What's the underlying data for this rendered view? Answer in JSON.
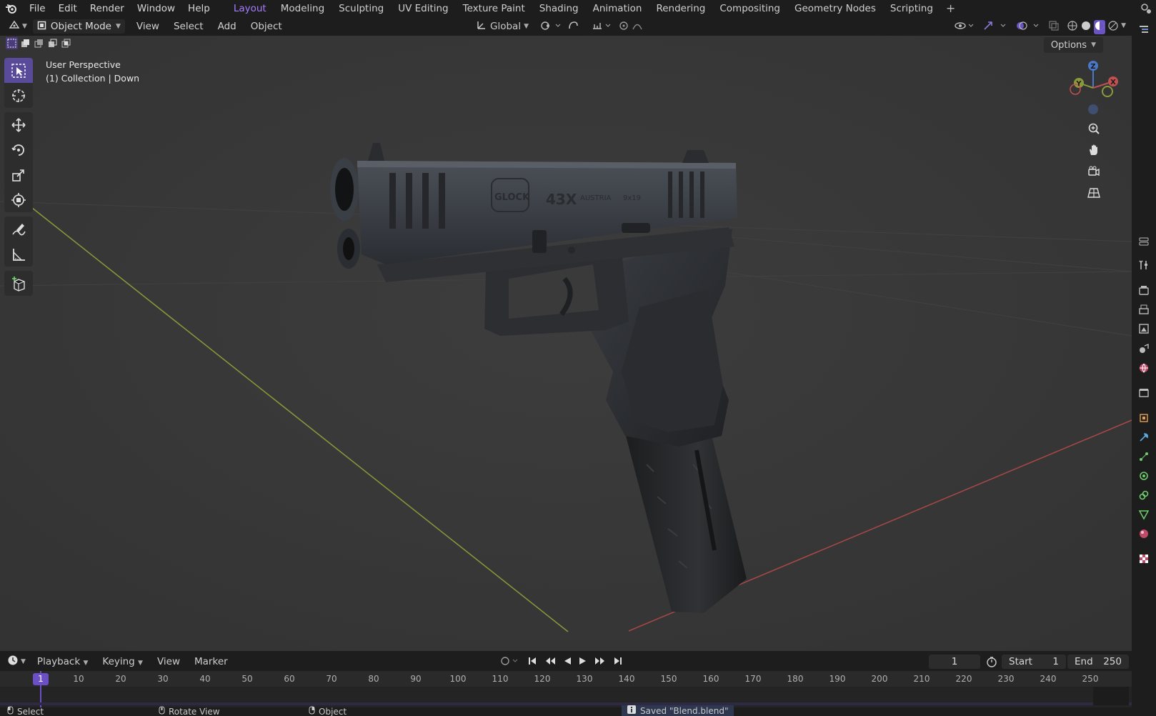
{
  "menu": {
    "file": "File",
    "edit": "Edit",
    "render": "Render",
    "window": "Window",
    "help": "Help"
  },
  "workspaces": [
    {
      "label": "Layout",
      "active": true
    },
    {
      "label": "Modeling"
    },
    {
      "label": "Sculpting"
    },
    {
      "label": "UV Editing"
    },
    {
      "label": "Texture Paint"
    },
    {
      "label": "Shading"
    },
    {
      "label": "Animation"
    },
    {
      "label": "Rendering"
    },
    {
      "label": "Compositing"
    },
    {
      "label": "Geometry Nodes"
    },
    {
      "label": "Scripting"
    }
  ],
  "workspace_add": "+",
  "viewport_header": {
    "mode": "Object Mode",
    "view": "View",
    "select": "Select",
    "add": "Add",
    "object": "Object",
    "orientation": "Global"
  },
  "viewport": {
    "perspective_label": "User Perspective",
    "collection_label": "(1) Collection | Down",
    "options_label": "Options",
    "gizmo_axes": {
      "z": "Z",
      "y": "Y",
      "x": "X"
    }
  },
  "timeline_header": {
    "playback": "Playback",
    "keying": "Keying",
    "view": "View",
    "marker": "Marker",
    "current_frame": "1",
    "start_label": "Start",
    "start_value": "1",
    "end_label": "End",
    "end_value": "250"
  },
  "timeline": {
    "current_frame_label": "1",
    "ticks": [
      "10",
      "20",
      "30",
      "40",
      "50",
      "60",
      "70",
      "80",
      "90",
      "100",
      "110",
      "120",
      "130",
      "140",
      "150",
      "160",
      "170",
      "180",
      "190",
      "200",
      "210",
      "220",
      "230",
      "240",
      "250"
    ]
  },
  "status": {
    "select": "Select",
    "rotate": "Rotate View",
    "object": "Object",
    "saved": "Saved \"Blend.blend\""
  },
  "colors": {
    "accent": "#a77cff",
    "viewport_bg": "#3a3a3a",
    "x_axis": "#c25050",
    "y_axis": "#8a9a3a",
    "z_axis": "#4a78c8"
  },
  "model_engraving": {
    "brand": "GLOCK",
    "model": "43X",
    "origin": "AUSTRIA",
    "caliber": "9x19"
  }
}
